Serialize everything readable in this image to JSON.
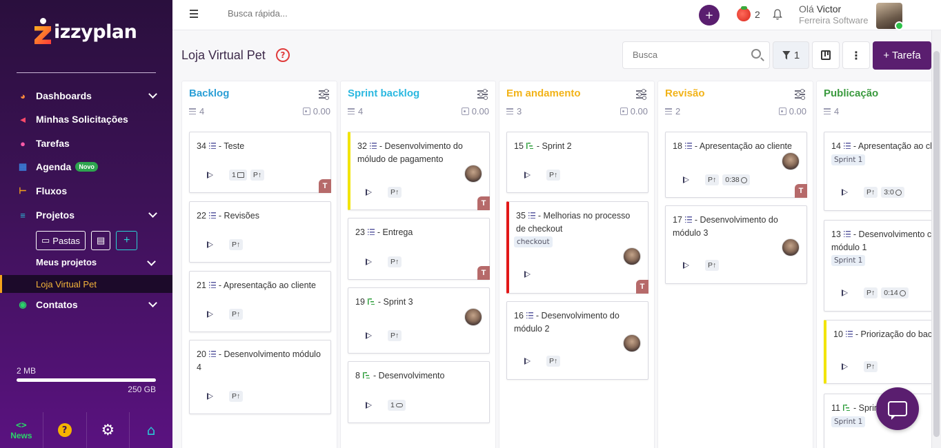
{
  "sidebar": {
    "logo_text": "izzyplan",
    "nav": [
      {
        "label": "Dashboards",
        "icon": "gauge-icon",
        "color": "#ff8a3d",
        "has_chevron": true
      },
      {
        "label": "Minhas Solicitações",
        "icon": "megaphone-icon",
        "color": "#ff4a6a",
        "has_chevron": false
      },
      {
        "label": "Tarefas",
        "icon": "users-icon",
        "color": "#ff5aa8",
        "has_chevron": false
      },
      {
        "label": "Agenda",
        "icon": "calendar-icon",
        "color": "#3a7bd5",
        "badge": "Novo",
        "has_chevron": false
      },
      {
        "label": "Fluxos",
        "icon": "flow-icon",
        "color": "#f4a31b",
        "has_chevron": false
      },
      {
        "label": "Projetos",
        "icon": "gantt-icon",
        "color": "#2bb6d4",
        "has_chevron": true
      },
      {
        "label": "Contatos",
        "icon": "contacts-icon",
        "color": "#2bd46a",
        "has_chevron": true
      }
    ],
    "projects": {
      "pastas_label": "Pastas",
      "meus_projetos": "Meus projetos",
      "active_project": "Loja Virtual Pet"
    },
    "storage": {
      "used": "2 MB",
      "total": "250 GB",
      "used_fraction": 0.01
    },
    "bottom": {
      "news_code": "<>",
      "news_label": "News",
      "help_label": "?"
    }
  },
  "topbar": {
    "search_placeholder": "Busca rápida...",
    "plus": "+",
    "tomato_count": "2",
    "greeting_prefix": "Olá",
    "user_name": "Victor",
    "company": "Ferreira Software"
  },
  "page": {
    "title": "Loja Virtual Pet",
    "help": "?",
    "search_placeholder": "Busca",
    "filter_count": "1",
    "more": "⋮",
    "new_task": "+ Tarefa"
  },
  "columns": [
    {
      "title": "Backlog",
      "color": "#2b9fd6",
      "count": "4",
      "points": "0.00"
    },
    {
      "title": "Sprint backlog",
      "color": "#2bb8e0",
      "count": "4",
      "points": "0.00"
    },
    {
      "title": "Em andamento",
      "color": "#f2b318",
      "count": "3",
      "points": "0.00"
    },
    {
      "title": "Revisão",
      "color": "#f2b318",
      "count": "2",
      "points": "0.00"
    },
    {
      "title": "Publicação",
      "color": "#3a9a3e",
      "count": "4",
      "points": ""
    }
  ],
  "cards": {
    "c34": {
      "num": "34",
      "title": "- Teste",
      "chips": [
        "1",
        "P↑"
      ],
      "owner": "T"
    },
    "c22": {
      "num": "22",
      "title": "- Revisões",
      "chips": [
        "P↑"
      ]
    },
    "c21": {
      "num": "21",
      "title": "- Apresentação ao cliente",
      "chips": [
        "P↑"
      ]
    },
    "c20": {
      "num": "20",
      "title": "- Desenvolvimento módulo 4",
      "chips": [
        "P↑"
      ]
    },
    "c32": {
      "num": "32",
      "title": "- Desenvolvimento do móludo de pagamento",
      "chips": [
        "P↑"
      ],
      "owner": "T"
    },
    "c23": {
      "num": "23",
      "title": "- Entrega",
      "chips": [
        "P↑"
      ],
      "owner": "T"
    },
    "c19": {
      "num": "19",
      "title": "- Sprint 3",
      "chips": [
        "P↑"
      ]
    },
    "c8": {
      "num": "8",
      "title": "- Desenvolvimento",
      "chips": [
        "1"
      ]
    },
    "c15": {
      "num": "15",
      "title": "- Sprint 2",
      "chips": [
        "P↑"
      ]
    },
    "c35": {
      "num": "35",
      "title": "- Melhorias no processo de checkout",
      "tag": "checkout",
      "owner": "T"
    },
    "c16": {
      "num": "16",
      "title": "- Desenvolvimento do módulo 2",
      "chips": [
        "P↑"
      ]
    },
    "c18": {
      "num": "18",
      "title": "- Apresentação ao cliente",
      "chips": [
        "P↑",
        "0:38"
      ],
      "owner": "T"
    },
    "c17": {
      "num": "17",
      "title": "- Desenvolvimento do módulo 3",
      "chips": [
        "P↑"
      ]
    },
    "c14": {
      "num": "14",
      "title": "- Apresentação ao cl",
      "tag": "Sprint 1",
      "chips": [
        "P↑",
        "3:0"
      ]
    },
    "c13": {
      "num": "13",
      "title": "- Desenvolvimento c módulo 1",
      "tag": "Sprint 1",
      "chips": [
        "P↑",
        "0:14"
      ]
    },
    "c10": {
      "num": "10",
      "title": "- Priorização do back",
      "chips": [
        "P↑"
      ]
    },
    "c11": {
      "num": "11",
      "title": "- Sprin",
      "tag": "Sprint 1"
    }
  }
}
